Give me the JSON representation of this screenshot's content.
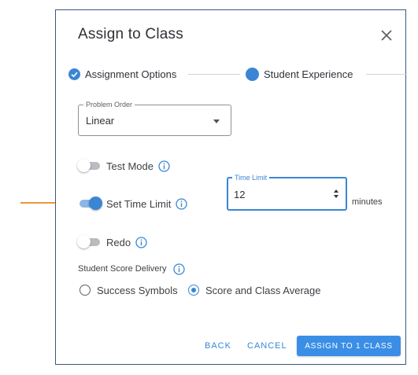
{
  "dialog": {
    "title": "Assign to Class"
  },
  "stepper": {
    "steps": [
      {
        "label": "Assignment Options",
        "state": "completed"
      },
      {
        "label": "Student Experience",
        "state": "active"
      }
    ]
  },
  "problem_order": {
    "label": "Problem Order",
    "value": "Linear"
  },
  "test_mode": {
    "label": "Test Mode",
    "on": false
  },
  "time_limit": {
    "label": "Set Time Limit",
    "on": true,
    "field_label": "Time Limit",
    "value": "12",
    "unit": "minutes"
  },
  "redo": {
    "label": "Redo",
    "on": false
  },
  "score_delivery": {
    "label": "Student Score Delivery",
    "options": [
      {
        "label": "Success Symbols",
        "selected": false
      },
      {
        "label": "Score and Class Average",
        "selected": true
      }
    ]
  },
  "actions": {
    "back": "BACK",
    "cancel": "CANCEL",
    "assign": "ASSIGN TO 1 CLASS"
  },
  "colors": {
    "accent": "#3a86d4",
    "annotation_arrow": "#f0953a",
    "dialog_border": "#39577c"
  },
  "icons": {
    "close": "close-icon",
    "check": "check-circle-icon",
    "info": "info-icon",
    "dropdown": "caret-down-icon",
    "spinner": "spinner-arrows-icon",
    "annotation": "arrow-right-icon"
  }
}
